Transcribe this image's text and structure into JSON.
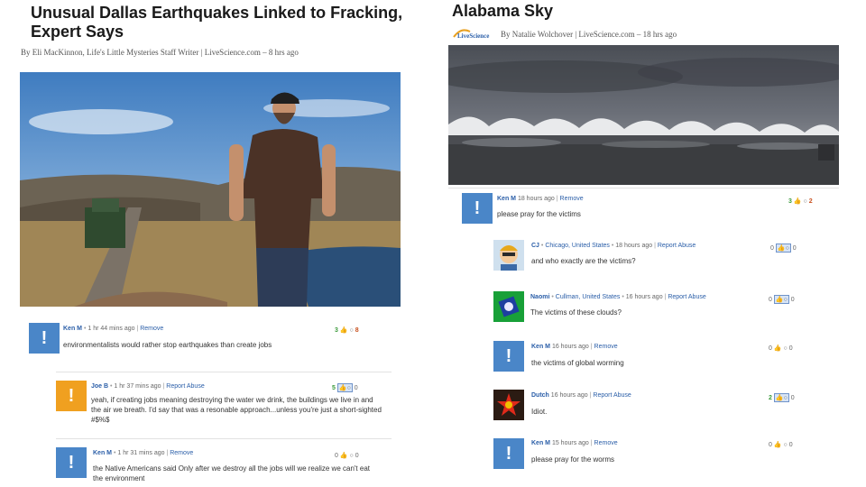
{
  "left": {
    "title": "Unusual Dallas Earthquakes Linked to Fracking, Expert Says",
    "byline": "By Eli MacKinnon, Life's Little Mysteries Staff Writer | LiveScience.com – 8 hrs ago",
    "comments": [
      {
        "name": "Ken M",
        "time": "1 hr 44 mins ago",
        "action": "Remove",
        "text": "environmentalists would rather stop earthquakes than create jobs",
        "up": "3",
        "down": "8",
        "avatar_color": "#4a86c8"
      },
      {
        "name": "Joe B",
        "time": "1 hr 37 mins ago",
        "action": "Report Abuse",
        "text": "yeah, if creating jobs meaning destroying the water we drink, the buildings we live in and the air we breath. I'd say that was a resonable approach...unless you're just a short-sighted #$%$",
        "up": "5",
        "down": "0",
        "avatar_color": "#f0a020"
      },
      {
        "name": "Ken M",
        "time": "1 hr 31 mins ago",
        "action": "Remove",
        "text": "the Native Americans said Only after we destroy all the jobs will we realize we can't eat the environment",
        "up": "0",
        "down": "0",
        "avatar_color": "#4a86c8"
      }
    ]
  },
  "right": {
    "title": "Alabama Sky",
    "logo_text": "LiveScience",
    "byline": "By Natalie Wolchover | LiveScience.com – 18 hrs ago",
    "comments": [
      {
        "name": "Ken M",
        "time": "18 hours ago",
        "action": "Remove",
        "text": "please pray for the victims",
        "up": "3",
        "down": "2",
        "avatar_color": "#4a86c8"
      },
      {
        "name": "CJ",
        "location": "Chicago, United States",
        "time": "18 hours ago",
        "action": "Report Abuse",
        "text": "and who exactly are the victims?",
        "up": "0",
        "down": "0"
      },
      {
        "name": "Naomi",
        "location": "Cullman, United States",
        "time": "16 hours ago",
        "action": "Report Abuse",
        "text": "The victims of these clouds?",
        "up": "0",
        "down": "0"
      },
      {
        "name": "Ken M",
        "time": "16 hours ago",
        "action": "Remove",
        "text": "the victims of global worming",
        "up": "0",
        "down": "0",
        "avatar_color": "#4a86c8"
      },
      {
        "name": "Dutch",
        "time": "16 hours ago",
        "action": "Report Abuse",
        "text": "Idiot.",
        "up": "2",
        "down": "0"
      },
      {
        "name": "Ken M",
        "time": "15 hours ago",
        "action": "Remove",
        "text": "please pray for the worms",
        "up": "0",
        "down": "0",
        "avatar_color": "#4a86c8"
      }
    ]
  },
  "icons": {
    "avatar_default": "exclamation-icon",
    "thumb_up": "thumbs-up-icon",
    "comment": "speech-bubble-icon"
  }
}
